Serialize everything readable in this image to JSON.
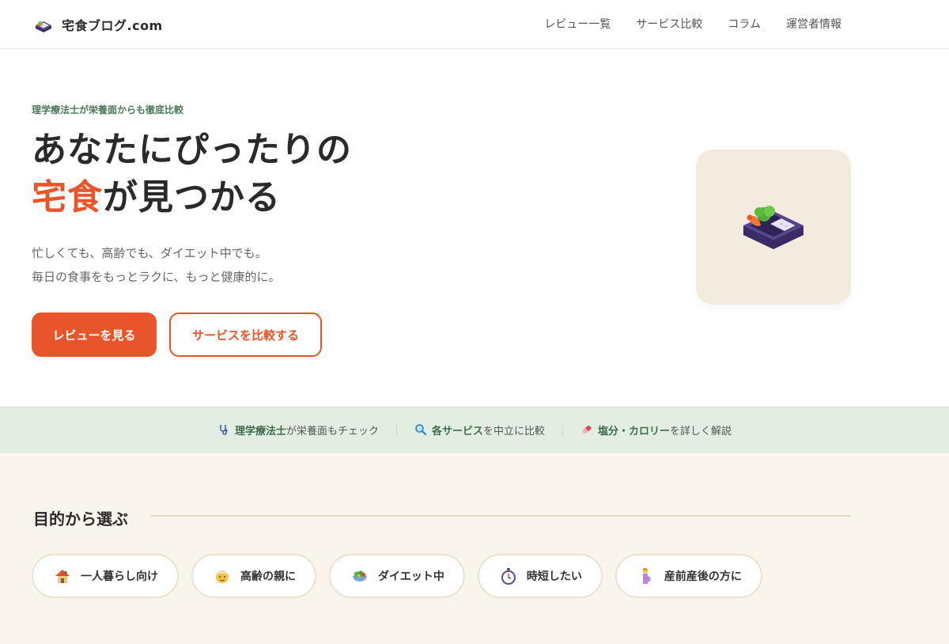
{
  "header": {
    "logo_text": "宅食ブログ.com",
    "nav": [
      "レビュー一覧",
      "サービス比較",
      "コラム",
      "運営者情報"
    ]
  },
  "hero": {
    "eyebrow": "理学療法士が栄養面からも徹底比較",
    "headline_line1": "あなたにぴったりの",
    "headline_accent": "宅食",
    "headline_rest": "が見つかる",
    "lead_line1": "忙しくても、高齢でも、ダイエット中でも。",
    "lead_line2": "毎日の食事をもっとラクに、もっと健康的に。",
    "primary_button": "レビューを見る",
    "secondary_button": "サービスを比較する"
  },
  "features": [
    {
      "icon": "stethoscope-icon",
      "bold": "理学療法士",
      "text": "が栄養面もチェック"
    },
    {
      "icon": "magnifier-icon",
      "bold": "各サービス",
      "text": "を中立に比較"
    },
    {
      "icon": "pill-icon",
      "bold": "塩分・カロリー",
      "text": "を詳しく解説"
    }
  ],
  "purpose": {
    "title": "目的から選ぶ",
    "chips": [
      {
        "icon": "house-icon",
        "label": "一人暮らし向け"
      },
      {
        "icon": "elder-icon",
        "label": "高齢の親に"
      },
      {
        "icon": "salad-icon",
        "label": "ダイエット中"
      },
      {
        "icon": "stopwatch-icon",
        "label": "時短したい"
      },
      {
        "icon": "pregnant-icon",
        "label": "産前産後の方に"
      }
    ]
  },
  "colors": {
    "accent": "#e8552a",
    "green": "#4a7a57",
    "strip_bg": "#e3eee3",
    "section_bg": "#faf5ec",
    "card_bg": "#f3ebde"
  }
}
